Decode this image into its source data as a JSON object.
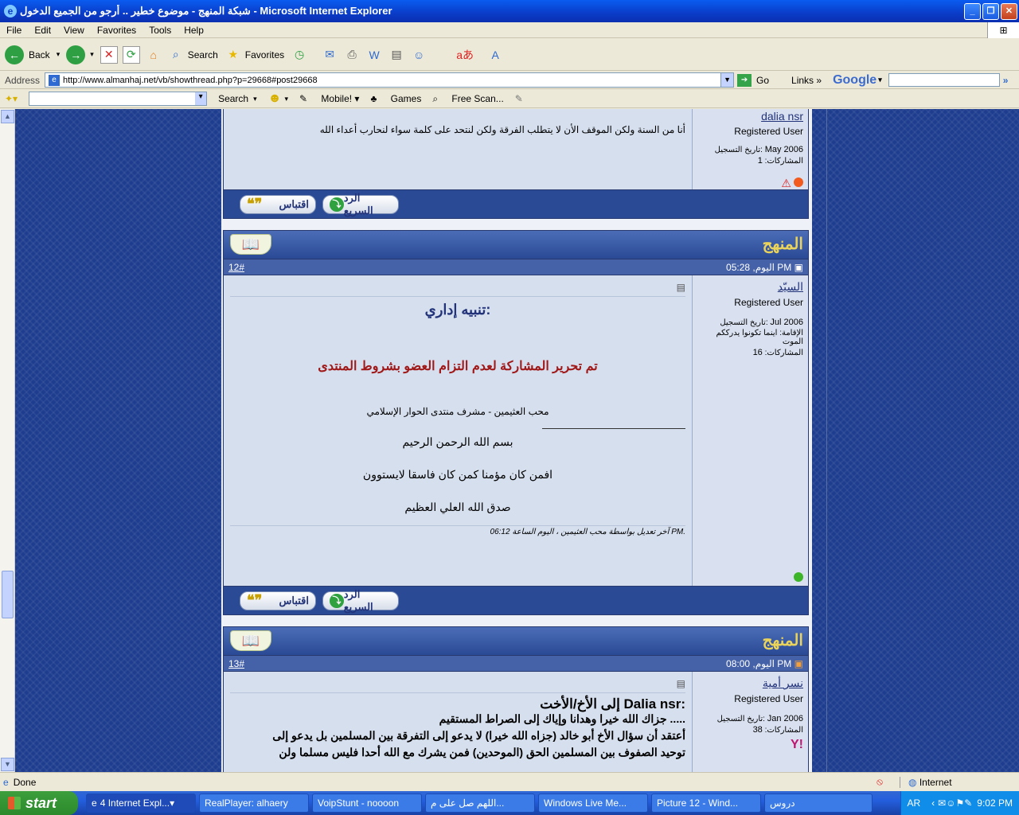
{
  "window": {
    "title": "شبكة المنهج - موضوع خطير .. أرجو من الجميع الدخول - Microsoft Internet Explorer"
  },
  "menu": [
    "File",
    "Edit",
    "View",
    "Favorites",
    "Tools",
    "Help"
  ],
  "toolbar": {
    "back": "Back",
    "search": "Search",
    "favorites": "Favorites"
  },
  "address": {
    "label": "Address",
    "url": "http://www.almanhaj.net/vb/showthread.php?p=29668#post29668",
    "go": "Go",
    "links": "Links",
    "google": "Google"
  },
  "toolbar2": {
    "search": "Search",
    "mobile": "Mobile!",
    "games": "Games",
    "freescan": "Free Scan..."
  },
  "posts": [
    {
      "username": "dalia nsr",
      "role": "Registered User",
      "join_label": "تاريخ التسجيل:",
      "join": "May 2006",
      "posts_label": "المشاركات:",
      "posts": "1",
      "text": "أنا من السنة ولكن الموقف الأن لا يتطلب الفرقة ولكن لنتحد على كلمة سواء لنحارب أعداء الله"
    },
    {
      "number": "12#",
      "date": "اليوم, 05:28 PM",
      "username": "السيّد",
      "role": "Registered User",
      "join_label": "تاريخ التسجيل:",
      "join": "Jul 2006",
      "location_label": "الإقامة:",
      "location": "اينما تكونوا يدرككم الموت",
      "posts_label": "المشاركات:",
      "posts": "16",
      "heading": "تنبيه إداري:",
      "warning": "تم تحرير المشاركة لعدم التزام العضو بشروط المنتدى",
      "signer": "محب العثيمين - مشرف منتدى الحوار الإسلامي",
      "line1": "بسم الله الرحمن الرحيم",
      "line2": "افمن كان مؤمنا كمن كان فاسقا لايستوون",
      "line3": "صدق الله العلي العظيم",
      "edit_note": "آخر تعديل بواسطة محب العثيمين ، اليوم الساعة 06:12 PM."
    },
    {
      "number": "13#",
      "date": "اليوم, 08:00 PM",
      "username": "نسر أمية",
      "role": "Registered User",
      "join_label": "تاريخ التسجيل:",
      "join": "Jan 2006",
      "posts_label": "المشاركات:",
      "posts": "38",
      "greeting": "إلى الأخ/الأخت Dalia nsr:",
      "p1": "جزاك الله خيرا وهدانا وإياك إلى الصراط المستقيم .....",
      "p2": "أعتقد أن سؤال الأخ أبو خالد (جزاه الله خيرا) لا يدعو إلى التفرقة بين المسلمين بل يدعو إلى",
      "p3": "توحيد الصفوف بين المسلمين الحق (الموحدين) فمن يشرك مع الله أحدا فليس مسلما ولن"
    }
  ],
  "buttons": {
    "quote": "اقتباس",
    "quick_reply": "الرد السريع"
  },
  "status": {
    "text": "Done",
    "zone": "Internet"
  },
  "taskbar": {
    "start": "start",
    "items": [
      "4 Internet Expl...",
      "RealPlayer: alhaery",
      "VoipStunt - noooon",
      "اللهم صل على م...",
      "Windows Live Me...",
      "Picture 12 - Wind...",
      "دروس"
    ],
    "lang": "AR",
    "clock": "9:02 PM"
  }
}
